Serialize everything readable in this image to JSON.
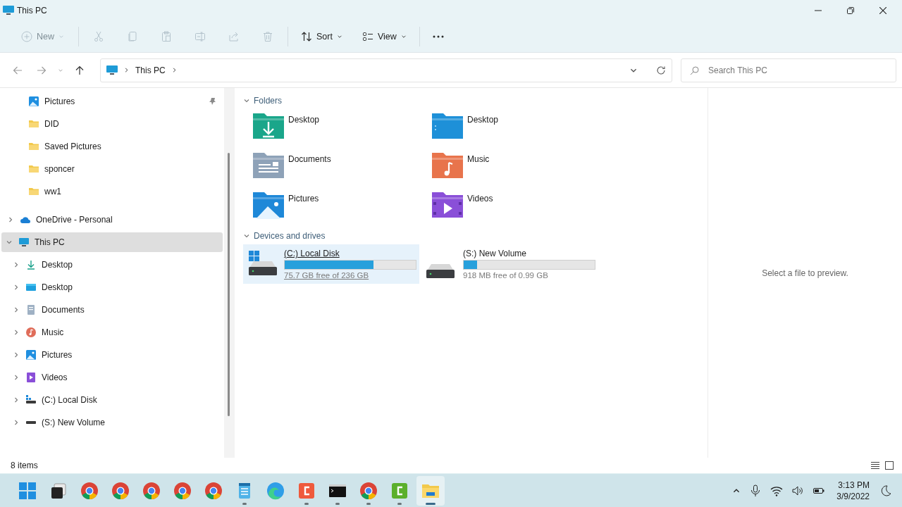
{
  "window": {
    "title": "This PC"
  },
  "toolbar": {
    "items": [
      {
        "kind": "new",
        "label": "New",
        "disabled": true
      },
      {
        "kind": "cut",
        "disabled": true
      },
      {
        "kind": "copy",
        "disabled": true
      },
      {
        "kind": "paste",
        "disabled": true
      },
      {
        "kind": "rename",
        "disabled": true
      },
      {
        "kind": "share",
        "disabled": true
      },
      {
        "kind": "delete",
        "disabled": true
      },
      {
        "kind": "sort",
        "label": "Sort",
        "disabled": false
      },
      {
        "kind": "view",
        "label": "View",
        "disabled": false
      },
      {
        "kind": "more",
        "disabled": false
      }
    ]
  },
  "address_bar": {
    "path": [
      "This PC"
    ]
  },
  "search": {
    "placeholder": "Search This PC"
  },
  "sidebar": {
    "quick_access": [
      {
        "label": "Pictures",
        "kind": "pictures",
        "pinned": true,
        "selected": false
      },
      {
        "label": "DID",
        "kind": "folder",
        "pinned": false,
        "selected": false
      },
      {
        "label": "Saved Pictures",
        "kind": "folder",
        "pinned": false,
        "selected": false
      },
      {
        "label": "sponcer",
        "kind": "folder",
        "pinned": false,
        "selected": false
      },
      {
        "label": "ww1",
        "kind": "folder",
        "pinned": false,
        "selected": false
      }
    ],
    "tree": [
      {
        "label": "OneDrive - Personal",
        "kind": "onedrive",
        "expanded": false,
        "selected": false
      },
      {
        "label": "This PC",
        "kind": "pc",
        "expanded": true,
        "selected": true,
        "children": [
          {
            "label": "Desktop",
            "kind": "downloads",
            "expanded": false,
            "selected": false
          },
          {
            "label": "Desktop",
            "kind": "desktop",
            "expanded": false,
            "selected": false
          },
          {
            "label": "Documents",
            "kind": "documents",
            "expanded": false,
            "selected": false
          },
          {
            "label": "Music",
            "kind": "music",
            "expanded": false,
            "selected": false
          },
          {
            "label": "Pictures",
            "kind": "pictures",
            "expanded": false,
            "selected": false
          },
          {
            "label": "Videos",
            "kind": "videos",
            "expanded": false,
            "selected": false
          },
          {
            "label": "(C:) Local Disk",
            "kind": "system",
            "expanded": false,
            "selected": false
          },
          {
            "label": "(S:) New Volume",
            "kind": "drive",
            "expanded": false,
            "selected": false
          }
        ]
      }
    ]
  },
  "sections": [
    {
      "kind": "folders",
      "title": "Folders",
      "expanded": true,
      "items": [
        {
          "name": "Desktop",
          "kind": "downloads"
        },
        {
          "name": "Desktop",
          "kind": "desktop"
        },
        {
          "name": "Documents",
          "kind": "documents"
        },
        {
          "name": "Music",
          "kind": "music"
        },
        {
          "name": "Pictures",
          "kind": "pictures"
        },
        {
          "name": "Videos",
          "kind": "videos"
        }
      ]
    },
    {
      "kind": "drives",
      "title": "Devices and drives",
      "expanded": true,
      "items": [
        {
          "name": "(C:) Local Disk",
          "kind": "system",
          "level": 0.68,
          "reading": "75.7 GB free of 236 GB",
          "selected": true
        },
        {
          "name": "(S:) New Volume",
          "kind": "drive",
          "level": 0.1,
          "reading": "918 MB free of 0.99 GB",
          "selected": false
        }
      ]
    }
  ],
  "preview": {
    "message": "Select a file to preview."
  },
  "status_bar": {
    "count": "8 items"
  },
  "taskbar": {
    "apps": [
      {
        "kind": "start",
        "running": false,
        "active": false
      },
      {
        "kind": "taskview",
        "running": false,
        "active": false
      },
      {
        "kind": "browser",
        "running": false,
        "active": false
      },
      {
        "kind": "browser",
        "running": false,
        "active": false
      },
      {
        "kind": "browser",
        "running": false,
        "active": false
      },
      {
        "kind": "browser",
        "running": false,
        "active": false
      },
      {
        "kind": "browser",
        "running": false,
        "active": false
      },
      {
        "kind": "notepad",
        "running": true,
        "active": false
      },
      {
        "kind": "edge",
        "running": false,
        "active": false
      },
      {
        "kind": "app",
        "color": "#ef5a3c",
        "running": true,
        "active": false
      },
      {
        "kind": "terminal",
        "running": true,
        "active": false
      },
      {
        "kind": "browser",
        "running": true,
        "active": false
      },
      {
        "kind": "app",
        "color": "#5bb02c",
        "running": true,
        "active": false
      },
      {
        "kind": "folder",
        "running": true,
        "active": true
      }
    ]
  },
  "clock": {
    "time": "3:13 PM",
    "date": "3/9/2022"
  }
}
